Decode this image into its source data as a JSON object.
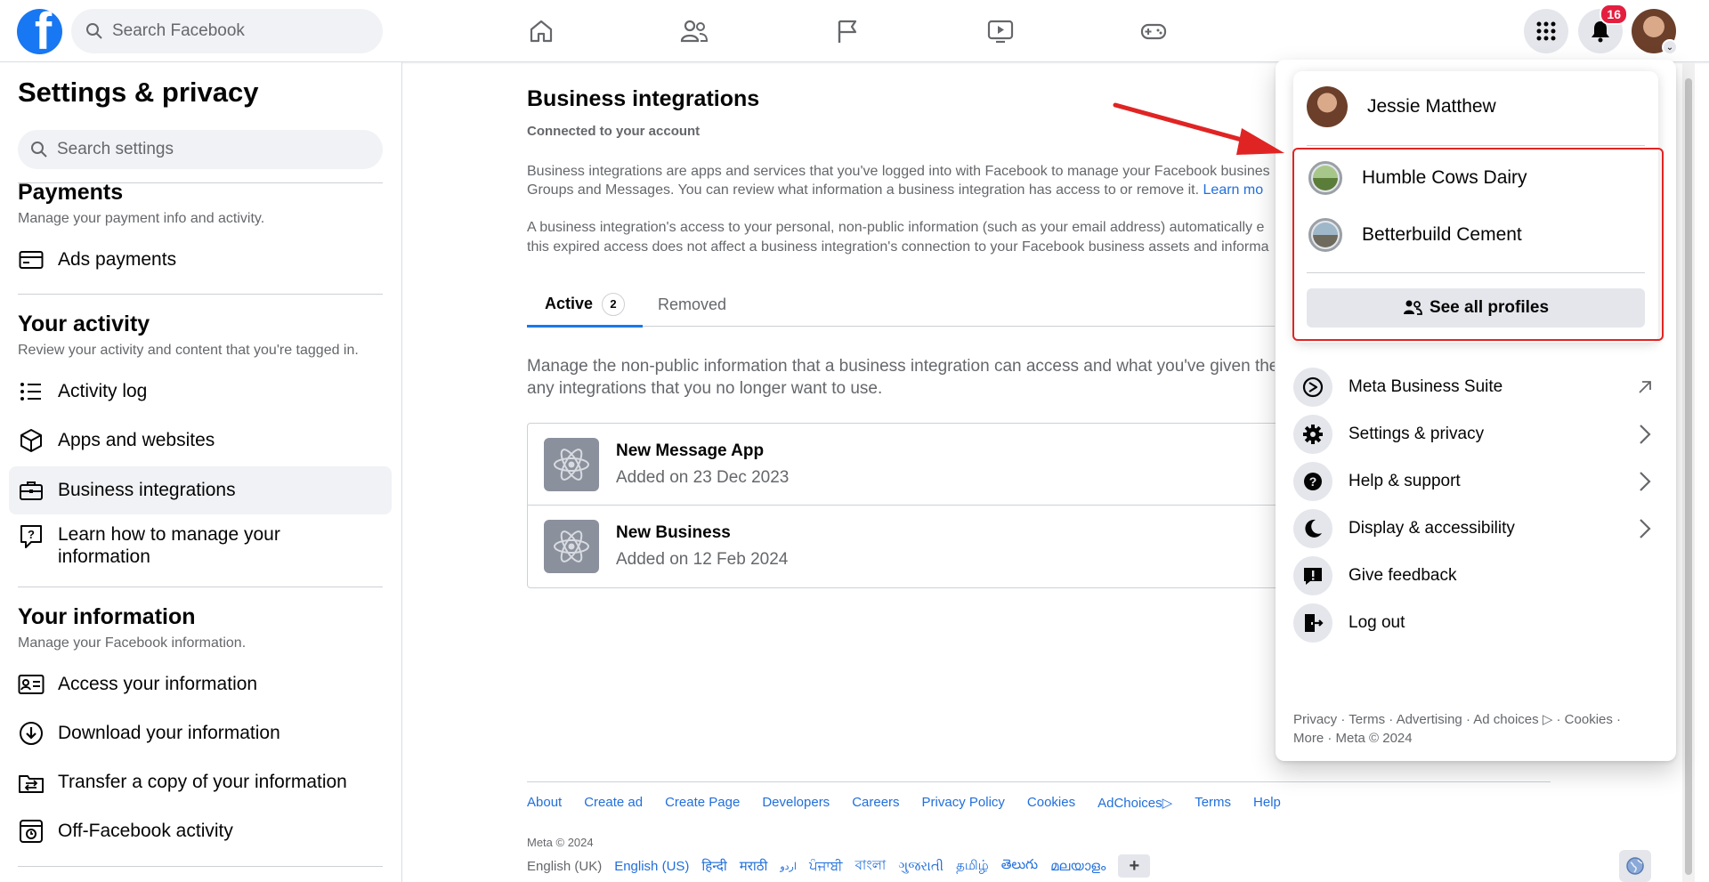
{
  "topbar": {
    "logo_letter": "f",
    "search_placeholder": "Search Facebook",
    "notification_count": "16"
  },
  "sidebar": {
    "title": "Settings & privacy",
    "search_placeholder": "Search settings",
    "sections": [
      {
        "heading": "Payments",
        "subtitle": "Manage your payment info and activity.",
        "items": [
          "Ads payments"
        ]
      },
      {
        "heading": "Your activity",
        "subtitle": "Review your activity and content that you're tagged in.",
        "items": [
          "Activity log",
          "Apps and websites",
          "Business integrations",
          "Learn how to manage your information"
        ]
      },
      {
        "heading": "Your information",
        "subtitle": "Manage your Facebook information.",
        "items": [
          "Access your information",
          "Download your information",
          "Transfer a copy of your information",
          "Off-Facebook activity"
        ]
      }
    ]
  },
  "main": {
    "title": "Business integrations",
    "subtitle": "Connected to your account",
    "para1_line1": "Business integrations are apps and services that you've logged into with Facebook to manage your Facebook busines",
    "para1_line2": "Groups and Messages. You can review what information a business integration has access to or remove it.",
    "para1_link": "Learn mo",
    "para2_line1": "A business integration's access to your personal, non-public information (such as your email address) automatically e",
    "para2_line2": "this expired access does not affect a business integration's connection to your Facebook business assets and informa",
    "tabs": [
      {
        "label": "Active",
        "count": "2"
      },
      {
        "label": "Removed"
      }
    ],
    "description_line1": "Manage the non-public information that a business integration can access and what you've given them",
    "description_line2": "any integrations that you no longer want to use.",
    "integrations": [
      {
        "name": "New Message App",
        "added": "Added on 23 Dec 2023"
      },
      {
        "name": "New Business",
        "added": "Added on 12 Feb 2024"
      }
    ]
  },
  "footer": {
    "links": [
      "About",
      "Create ad",
      "Create Page",
      "Developers",
      "Careers",
      "Privacy Policy",
      "Cookies",
      "AdChoices",
      "Terms",
      "Help"
    ],
    "copyright": "Meta © 2024",
    "current_language": "English (UK)",
    "languages": [
      "English (US)",
      "हिन्दी",
      "मराठी",
      "اردو",
      "ਪੰਜਾਬੀ",
      "বাংলা",
      "ગુજરાતી",
      "தமிழ்",
      "తెలుగు",
      "മലയാളം"
    ],
    "add_language": "+"
  },
  "dropdown": {
    "user_name": "Jessie Matthew",
    "profiles": [
      "Humble Cows Dairy",
      "Betterbuild Cement"
    ],
    "see_all": "See all profiles",
    "menu": [
      {
        "label": "Meta Business Suite",
        "icon": "business-suite-icon",
        "arrow": "external-link-icon"
      },
      {
        "label": "Settings & privacy",
        "icon": "gear-icon",
        "arrow": "chevron-right-icon"
      },
      {
        "label": "Help & support",
        "icon": "question-icon",
        "arrow": "chevron-right-icon"
      },
      {
        "label": "Display & accessibility",
        "icon": "moon-icon",
        "arrow": "chevron-right-icon"
      },
      {
        "label": "Give feedback",
        "icon": "feedback-icon"
      },
      {
        "label": "Log out",
        "icon": "logout-icon"
      }
    ],
    "footer_line1": "Privacy · Terms · Advertising · Ad choices ▷ · Cookies ·",
    "footer_line2": "More · Meta © 2024"
  },
  "colors": {
    "brand": "#1877f2",
    "highlight": "#e02424",
    "link": "#216fdb",
    "badge": "#e41e3f"
  }
}
